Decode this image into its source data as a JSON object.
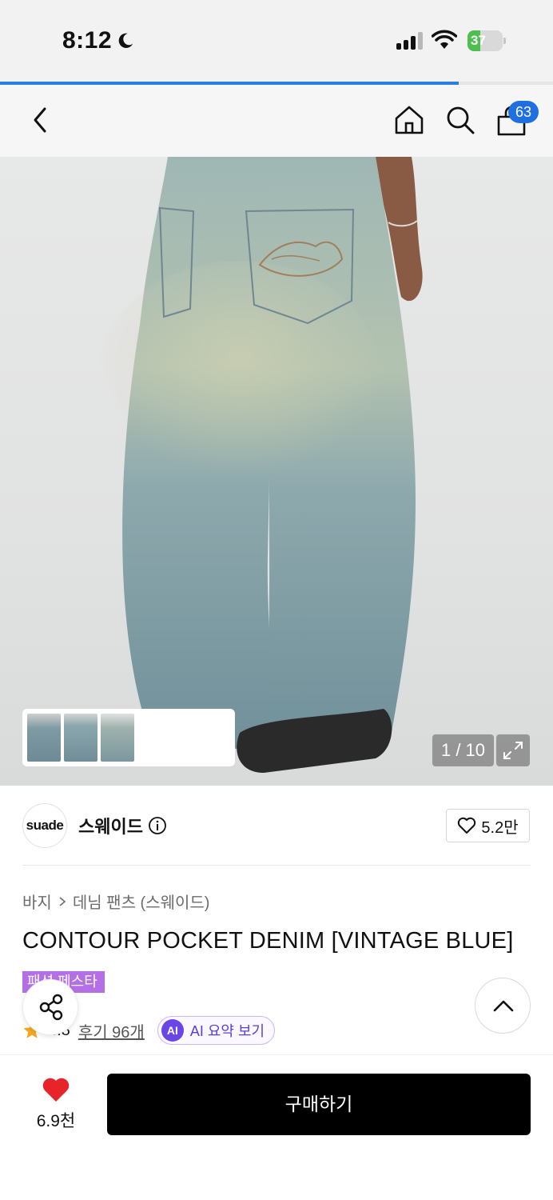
{
  "status_bar": {
    "time": "8:12",
    "battery": "37",
    "battery_fraction": 0.37
  },
  "page_load_progress": 0.83,
  "header": {
    "cart_count": "63"
  },
  "gallery": {
    "counter": "1 / 10",
    "thumbnail_count": 3
  },
  "brand": {
    "logo_text": "suade",
    "name": "스웨이드",
    "likes": "5.2만"
  },
  "breadcrumb": [
    "바지",
    "데님 팬츠 (스웨이드)"
  ],
  "product": {
    "title": "CONTOUR POCKET DENIM [VINTAGE BLUE]",
    "event_badge": "패션 페스타",
    "rating": "4.8",
    "reviews": "후기 96개",
    "ai_badge": "AI",
    "ai_summary": "AI 요약 보기"
  },
  "bottom_bar": {
    "wishlist_count": "6.9천",
    "buy_label": "구매하기"
  },
  "colors": {
    "accent_blue": "#1f6fe0",
    "buy_button": "#000000",
    "heart": "#e8242b",
    "event_purple": "#b46ee6",
    "ai_purple": "#6b45e6"
  }
}
